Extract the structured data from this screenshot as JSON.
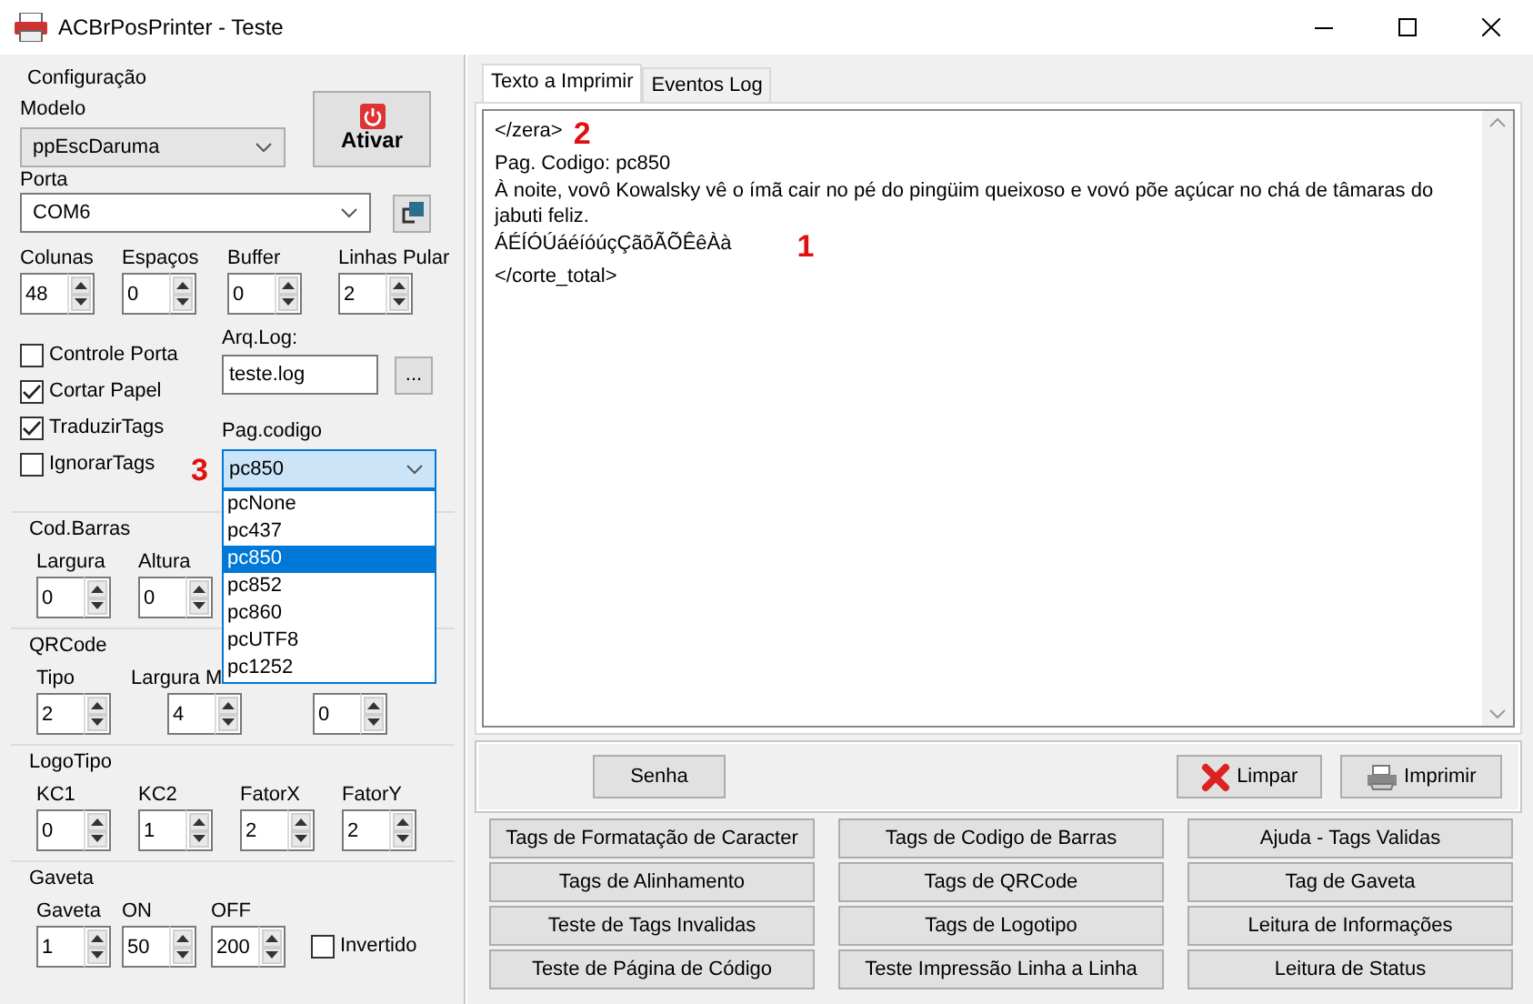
{
  "window": {
    "title": "ACBrPosPrinter - Teste"
  },
  "config": {
    "title": "Configuração",
    "modelo": {
      "label": "Modelo",
      "value": "ppEscDaruma"
    },
    "ativar_button": "Ativar",
    "porta": {
      "label": "Porta",
      "value": "COM6"
    },
    "spinners": [
      {
        "label": "Colunas",
        "value": "48"
      },
      {
        "label": "Espaços",
        "value": "0"
      },
      {
        "label": "Buffer",
        "value": "0"
      },
      {
        "label": "Linhas Pular",
        "value": "2"
      }
    ],
    "checkboxes": [
      {
        "label": "Controle Porta",
        "checked": false
      },
      {
        "label": "Cortar Papel",
        "checked": true
      },
      {
        "label": "TraduzirTags",
        "checked": true
      },
      {
        "label": "IgnorarTags",
        "checked": false
      }
    ],
    "arq_log": {
      "label": "Arq.Log:",
      "value": "teste.log",
      "browse_button": "..."
    },
    "pag_codigo": {
      "label": "Pag.codigo",
      "value": "pc850",
      "annotation": "3",
      "expanded": true,
      "options": [
        {
          "label": "pcNone",
          "selected": false
        },
        {
          "label": "pc437",
          "selected": false
        },
        {
          "label": "pc850",
          "selected": true
        },
        {
          "label": "pc852",
          "selected": false
        },
        {
          "label": "pc860",
          "selected": false
        },
        {
          "label": "pcUTF8",
          "selected": false
        },
        {
          "label": "pc1252",
          "selected": false
        }
      ]
    }
  },
  "groups": [
    {
      "title": "Cod.Barras",
      "spinners": [
        {
          "label": "Largura",
          "value": "0"
        },
        {
          "label": "Altura",
          "value": "0"
        }
      ]
    },
    {
      "title": "QRCode",
      "spinners": [
        {
          "label": "Tipo",
          "value": "2"
        },
        {
          "label": "Largura M",
          "value": "4"
        },
        {
          "value": "0"
        }
      ]
    },
    {
      "title": "LogoTipo",
      "spinners": [
        {
          "label": "KC1",
          "value": "0"
        },
        {
          "label": "KC2",
          "value": "1"
        },
        {
          "label": "FatorX",
          "value": "2"
        },
        {
          "label": "FatorY",
          "value": "2"
        }
      ]
    },
    {
      "title": "Gaveta",
      "spinners": [
        {
          "label": "Gaveta",
          "value": "1"
        },
        {
          "label": "ON",
          "value": "50"
        },
        {
          "label": "OFF",
          "value": "200"
        }
      ],
      "checkboxes": [
        {
          "label": "Invertido",
          "checked": false
        }
      ]
    }
  ],
  "tabs": [
    {
      "label": "Texto a Imprimir",
      "selected": true
    },
    {
      "label": "Eventos Log",
      "selected": false
    }
  ],
  "editor_lines": [
    {
      "text": "</zera>",
      "annotation": "2"
    },
    {
      "text": "Pag. Codigo: pc850"
    },
    {
      "text": "À noite, vovô Kowalsky vê o ímã cair no pé do pingüim queixoso e vovó põe açúcar no chá de tâmaras do jabuti feliz."
    },
    {
      "text": "ÁÉÍÓÚáéíóúçÇãõÃÕÊêÀà",
      "annotation": "1"
    },
    {
      "text": "</corte_total>"
    }
  ],
  "action_buttons": [
    {
      "label": "Senha",
      "kind": "plain"
    },
    {
      "label": "Limpar",
      "kind": "clear"
    },
    {
      "label": "Imprimir",
      "kind": "print"
    }
  ],
  "tag_buttons": [
    "Tags de Formatação de Caracter",
    "Tags de Codigo de Barras",
    "Ajuda - Tags Validas",
    "Tags de Alinhamento",
    "Tags de QRCode",
    "Tag de Gaveta",
    "Teste de Tags Invalidas",
    "Tags de Logotipo",
    "Leitura de Informações",
    "Teste de Página de Código",
    "Teste Impressão Linha a Linha",
    "Leitura de Status"
  ]
}
